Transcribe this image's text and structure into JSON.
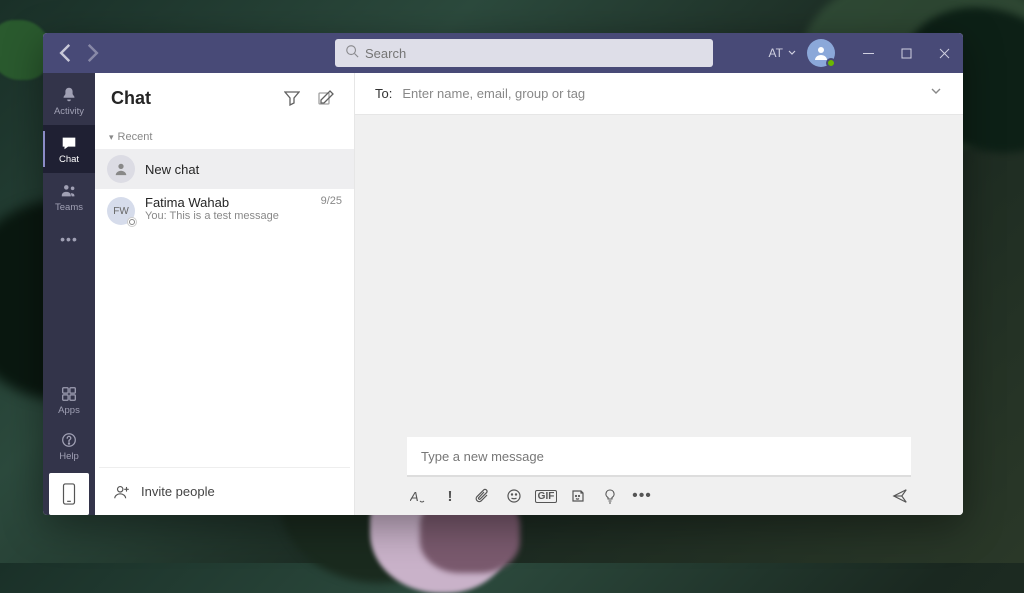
{
  "app": "Microsoft Teams",
  "titlebar": {
    "search_placeholder": "Search",
    "tenant_label": "AT"
  },
  "rail": {
    "activity": "Activity",
    "chat": "Chat",
    "teams": "Teams",
    "more": "•••",
    "apps": "Apps",
    "help": "Help"
  },
  "chat_panel": {
    "title": "Chat",
    "section_recent": "Recent",
    "new_chat_label": "New chat",
    "items": [
      {
        "initials": "FW",
        "name": "Fatima Wahab",
        "preview": "You: This is a test message",
        "date": "9/25"
      }
    ],
    "invite_label": "Invite people"
  },
  "conversation": {
    "to_label": "To:",
    "to_placeholder": "Enter name, email, group or tag",
    "compose_placeholder": "Type a new message"
  }
}
